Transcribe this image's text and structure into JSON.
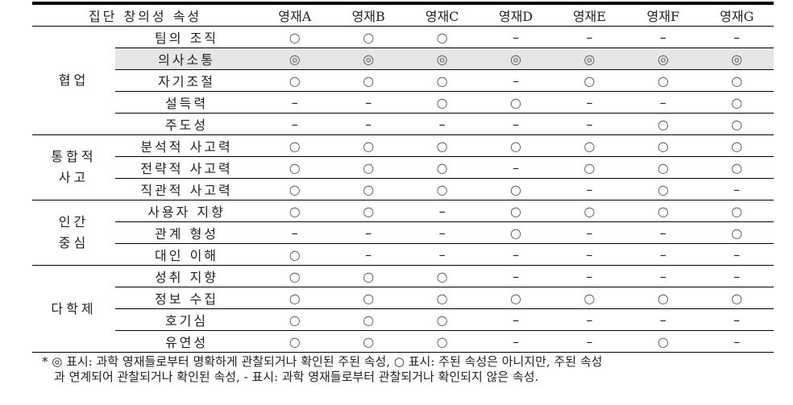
{
  "table": {
    "header": {
      "attribute": "집단 창의성 속성",
      "students": [
        "영재A",
        "영재B",
        "영재C",
        "영재D",
        "영재E",
        "영재F",
        "영재G"
      ]
    },
    "groups": [
      {
        "category": "협업",
        "rows": [
          {
            "attribute": "팀의 조직",
            "marks": [
              "○",
              "○",
              "○",
              "–",
              "–",
              "–",
              "–"
            ]
          },
          {
            "attribute": "의사소통",
            "marks": [
              "◎",
              "◎",
              "◎",
              "◎",
              "◎",
              "◎",
              "◎"
            ],
            "highlighted": true
          },
          {
            "attribute": "자기조절",
            "marks": [
              "○",
              "○",
              "○",
              "–",
              "○",
              "○",
              "○"
            ]
          },
          {
            "attribute": "설득력",
            "marks": [
              "–",
              "–",
              "○",
              "○",
              "–",
              "–",
              "○"
            ]
          },
          {
            "attribute": "주도성",
            "marks": [
              "–",
              "–",
              "–",
              "–",
              "–",
              "○",
              "○"
            ]
          }
        ]
      },
      {
        "category": "통합적\n사고",
        "rows": [
          {
            "attribute": "분석적 사고력",
            "marks": [
              "○",
              "○",
              "○",
              "○",
              "○",
              "○",
              "○"
            ]
          },
          {
            "attribute": "전략적 사고력",
            "marks": [
              "○",
              "○",
              "○",
              "–",
              "○",
              "○",
              "○"
            ]
          },
          {
            "attribute": "직관적 사고력",
            "marks": [
              "○",
              "○",
              "○",
              "○",
              "–",
              "○",
              "–"
            ]
          }
        ]
      },
      {
        "category": "인간\n중심",
        "rows": [
          {
            "attribute": "사용자 지향",
            "marks": [
              "○",
              "○",
              "–",
              "○",
              "○",
              "○",
              "○"
            ]
          },
          {
            "attribute": "관계 형성",
            "marks": [
              "–",
              "–",
              "–",
              "○",
              "–",
              "–",
              "○"
            ]
          },
          {
            "attribute": "대인 이해",
            "marks": [
              "○",
              "–",
              "–",
              "–",
              "–",
              "–",
              "–"
            ]
          }
        ]
      },
      {
        "category": "다학제",
        "rows": [
          {
            "attribute": "성취 지향",
            "marks": [
              "○",
              "○",
              "○",
              "–",
              "–",
              "–",
              "–"
            ]
          },
          {
            "attribute": "정보 수집",
            "marks": [
              "○",
              "○",
              "○",
              "○",
              "○",
              "○",
              "○"
            ]
          },
          {
            "attribute": "호기심",
            "marks": [
              "○",
              "○",
              "○",
              "–",
              "–",
              "–",
              "–"
            ]
          },
          {
            "attribute": "유연성",
            "marks": [
              "○",
              "○",
              "○",
              "–",
              "–",
              "○",
              "–"
            ]
          }
        ]
      }
    ]
  },
  "footnote": {
    "line1": "* ◎ 표시: 과학 영재들로부터 명확하게 관찰되거나 확인된 주된 속성, ○ 표시: 주된 속성은 아니지만, 주된 속성",
    "line2": "과 연계되어 관찰되거나 확인된 속성, - 표시: 과학 영재들로부터 관찰되거나 확인되지 않은 속성."
  },
  "colors": {
    "highlight_row": "#e6e6e6",
    "rule": "#000000"
  }
}
